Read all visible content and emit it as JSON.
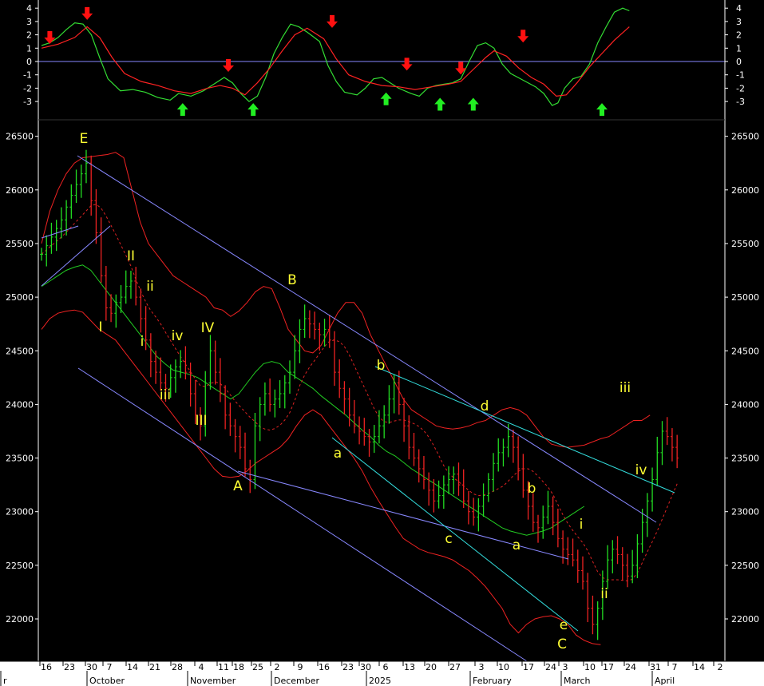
{
  "chart_data": [
    {
      "type": "line",
      "panel": "oscillator",
      "ylim": [
        -4,
        4
      ],
      "y_ticks": [
        4,
        3,
        2,
        1,
        0,
        -1,
        -2,
        -3
      ],
      "zero_line": true,
      "series": [
        {
          "color": "#33dd33",
          "points": [
            [
              0,
              1.2
            ],
            [
              10,
              1.4
            ],
            [
              20,
              1.8
            ],
            [
              30,
              2.4
            ],
            [
              40,
              2.9
            ],
            [
              50,
              2.8
            ],
            [
              60,
              2.0
            ],
            [
              70,
              0.3
            ],
            [
              80,
              -1.3
            ],
            [
              95,
              -2.2
            ],
            [
              110,
              -2.1
            ],
            [
              125,
              -2.3
            ],
            [
              140,
              -2.7
            ],
            [
              155,
              -2.9
            ],
            [
              165,
              -2.4
            ],
            [
              180,
              -2.6
            ],
            [
              195,
              -2.2
            ],
            [
              210,
              -1.6
            ],
            [
              220,
              -1.2
            ],
            [
              230,
              -1.6
            ],
            [
              240,
              -2.4
            ],
            [
              250,
              -3.0
            ],
            [
              260,
              -2.6
            ],
            [
              270,
              -1.2
            ],
            [
              280,
              0.6
            ],
            [
              290,
              1.8
            ],
            [
              300,
              2.8
            ],
            [
              310,
              2.6
            ],
            [
              320,
              2.2
            ],
            [
              335,
              1.5
            ],
            [
              345,
              -0.3
            ],
            [
              355,
              -1.5
            ],
            [
              365,
              -2.3
            ],
            [
              380,
              -2.5
            ],
            [
              390,
              -2.0
            ],
            [
              400,
              -1.3
            ],
            [
              410,
              -1.2
            ],
            [
              420,
              -1.6
            ],
            [
              430,
              -2.0
            ],
            [
              445,
              -2.4
            ],
            [
              455,
              -2.6
            ],
            [
              465,
              -2.0
            ],
            [
              475,
              -1.8
            ],
            [
              485,
              -1.7
            ],
            [
              495,
              -1.6
            ],
            [
              505,
              -1.3
            ],
            [
              515,
              0.0
            ],
            [
              525,
              1.2
            ],
            [
              535,
              1.4
            ],
            [
              545,
              1.0
            ],
            [
              555,
              -0.2
            ],
            [
              565,
              -0.9
            ],
            [
              580,
              -1.4
            ],
            [
              595,
              -1.9
            ],
            [
              605,
              -2.4
            ],
            [
              615,
              -3.3
            ],
            [
              622,
              -3.1
            ],
            [
              630,
              -2.0
            ],
            [
              640,
              -1.3
            ],
            [
              650,
              -1.1
            ],
            [
              660,
              -0.2
            ],
            [
              670,
              1.4
            ],
            [
              680,
              2.6
            ],
            [
              690,
              3.7
            ],
            [
              700,
              4.0
            ],
            [
              708,
              3.8
            ]
          ]
        },
        {
          "color": "#ff2222",
          "points": [
            [
              0,
              1.0
            ],
            [
              20,
              1.3
            ],
            [
              40,
              1.8
            ],
            [
              55,
              2.6
            ],
            [
              70,
              1.8
            ],
            [
              85,
              0.3
            ],
            [
              100,
              -0.9
            ],
            [
              120,
              -1.5
            ],
            [
              140,
              -1.8
            ],
            [
              160,
              -2.2
            ],
            [
              180,
              -2.4
            ],
            [
              200,
              -2.0
            ],
            [
              215,
              -1.8
            ],
            [
              230,
              -2.0
            ],
            [
              245,
              -2.5
            ],
            [
              260,
              -1.6
            ],
            [
              275,
              -0.5
            ],
            [
              290,
              0.8
            ],
            [
              305,
              2.0
            ],
            [
              320,
              2.5
            ],
            [
              340,
              1.7
            ],
            [
              355,
              0.2
            ],
            [
              370,
              -1.0
            ],
            [
              390,
              -1.5
            ],
            [
              410,
              -1.8
            ],
            [
              430,
              -1.9
            ],
            [
              450,
              -2.1
            ],
            [
              470,
              -1.9
            ],
            [
              490,
              -1.7
            ],
            [
              505,
              -1.5
            ],
            [
              520,
              -0.6
            ],
            [
              535,
              0.3
            ],
            [
              545,
              0.8
            ],
            [
              560,
              0.4
            ],
            [
              575,
              -0.5
            ],
            [
              590,
              -1.2
            ],
            [
              605,
              -1.7
            ],
            [
              620,
              -2.6
            ],
            [
              632,
              -2.5
            ],
            [
              645,
              -1.6
            ],
            [
              660,
              -0.4
            ],
            [
              675,
              0.6
            ],
            [
              690,
              1.6
            ],
            [
              708,
              2.6
            ]
          ]
        }
      ],
      "signals": {
        "sell": [
          [
            10,
            1.8
          ],
          [
            55,
            3.6
          ],
          [
            225,
            -0.3
          ],
          [
            350,
            3.0
          ],
          [
            440,
            -0.2
          ],
          [
            505,
            -0.5
          ],
          [
            580,
            1.9
          ]
        ],
        "buy": [
          [
            170,
            -3.6
          ],
          [
            255,
            -3.6
          ],
          [
            415,
            -2.8
          ],
          [
            480,
            -3.2
          ],
          [
            520,
            -3.2
          ],
          [
            675,
            -3.6
          ]
        ]
      }
    },
    {
      "type": "bar",
      "panel": "price",
      "ylim": [
        21500,
        26700
      ],
      "y_ticks": [
        26500,
        26000,
        25500,
        25000,
        24500,
        24000,
        23500,
        23000,
        22500,
        22000
      ],
      "x_ticks": [
        "16",
        "23",
        "30",
        "7",
        "14",
        "21",
        "28",
        "4",
        "11",
        "18",
        "25",
        "2",
        "9",
        "16",
        "23",
        "30",
        "6",
        "13",
        "20",
        "27",
        "3",
        "10",
        "17",
        "24",
        "3",
        "10",
        "17",
        "24",
        "31",
        "7",
        "14",
        "2"
      ],
      "months": [
        "r",
        "October",
        "November",
        "December",
        "2025",
        "February",
        "March",
        "April"
      ],
      "close_series": [
        25400,
        25480,
        25560,
        25640,
        25720,
        25840,
        25950,
        26050,
        26150,
        26250,
        25900,
        25600,
        25200,
        24900,
        24850,
        24950,
        25000,
        25100,
        25150,
        25000,
        24800,
        24600,
        24400,
        24300,
        24200,
        24150,
        24250,
        24350,
        24400,
        24300,
        24100,
        23900,
        23800,
        24200,
        24500,
        24300,
        24100,
        23900,
        23800,
        23700,
        23600,
        23400,
        23300,
        23800,
        24000,
        24100,
        24000,
        24050,
        24100,
        24200,
        24300,
        24500,
        24700,
        24800,
        24750,
        24700,
        24650,
        24700,
        24600,
        24300,
        24150,
        24050,
        23900,
        23800,
        23750,
        23700,
        23650,
        23700,
        23800,
        23900,
        24050,
        24200,
        24000,
        23800,
        23600,
        23500,
        23400,
        23300,
        23200,
        23100,
        23150,
        23250,
        23300,
        23350,
        23250,
        23100,
        23000,
        22950,
        23050,
        23150,
        23300,
        23450,
        23550,
        23600,
        23700,
        23600,
        23400,
        23200,
        23050,
        22900,
        22850,
        22950,
        23050,
        22900,
        22750,
        22650,
        22600,
        22550,
        22450,
        22350,
        22100,
        21950,
        22100,
        22350,
        22550,
        22650,
        22600,
        22500,
        22400,
        22500,
        22700,
        22900,
        23100,
        23300,
        23550,
        23750,
        23700,
        23600,
        23500
      ],
      "bollinger": {
        "upper": [
          25500,
          25800,
          26000,
          26150,
          26250,
          26300,
          26310,
          26320,
          26330,
          26350,
          26300,
          26000,
          25700,
          25500,
          25400,
          25300,
          25200,
          25150,
          25100,
          25050,
          25000,
          24900,
          24880,
          24820,
          24870,
          24950,
          25050,
          25100,
          25080,
          24900,
          24700,
          24600,
          24500,
          24480,
          24550,
          24700,
          24850,
          24950,
          24950,
          24850,
          24650,
          24500,
          24350,
          24200,
          24050,
          23950,
          23900,
          23850,
          23800,
          23780,
          23770,
          23780,
          23800,
          23830,
          23850,
          23900,
          23950,
          23970,
          23950,
          23900,
          23800,
          23700,
          23630,
          23610,
          23600,
          23610,
          23620,
          23650,
          23680,
          23700,
          23750,
          23800,
          23850,
          23850,
          23900
        ],
        "middle": [
          25100,
          25150,
          25200,
          25250,
          25280,
          25300,
          25250,
          25150,
          25050,
          24950,
          24850,
          24750,
          24650,
          24550,
          24450,
          24380,
          24320,
          24300,
          24280,
          24250,
          24200,
          24150,
          24100,
          24050,
          24100,
          24200,
          24300,
          24380,
          24400,
          24380,
          24300,
          24250,
          24200,
          24150,
          24080,
          24020,
          23960,
          23900,
          23830,
          23760,
          23700,
          23620,
          23560,
          23520,
          23460,
          23400,
          23350,
          23300,
          23250,
          23200,
          23150,
          23100,
          23050,
          23000,
          22950,
          22900,
          22850,
          22820,
          22800,
          22780,
          22800,
          22820,
          22850,
          22900,
          22950,
          23000,
          23050
        ],
        "lower": [
          24700,
          24800,
          24850,
          24870,
          24880,
          24860,
          24780,
          24700,
          24650,
          24600,
          24500,
          24400,
          24300,
          24200,
          24100,
          24000,
          23900,
          23800,
          23700,
          23600,
          23500,
          23400,
          23330,
          23320,
          23330,
          23380,
          23450,
          23500,
          23550,
          23600,
          23680,
          23800,
          23900,
          23950,
          23900,
          23800,
          23700,
          23600,
          23500,
          23380,
          23230,
          23100,
          22980,
          22860,
          22750,
          22700,
          22650,
          22620,
          22600,
          22580,
          22550,
          22500,
          22450,
          22380,
          22300,
          22200,
          22100,
          21950,
          21870,
          21950,
          22000,
          22020,
          22030,
          22000,
          21950,
          21850,
          21800,
          21770,
          21760
        ]
      },
      "trendlines": [
        {
          "color": "#8888ff",
          "from": [
            "E",
            26250
          ],
          "to": [
            "mar-end",
            22830
          ]
        },
        {
          "color": "#8888ff",
          "from": [
            "sep-16",
            24200
          ],
          "to": [
            "feb-24",
            21600
          ]
        },
        {
          "color": "#8888ff",
          "from": [
            "A",
            23300
          ],
          "to": [
            "mar-3",
            22500
          ]
        },
        {
          "color": "#8888ff",
          "from": [
            "sep-16",
            25400
          ],
          "to": [
            "sep-30",
            25570
          ]
        },
        {
          "color": "#8888ff",
          "from": [
            "sep-16",
            25000
          ],
          "to": [
            "oct-7",
            25600
          ]
        },
        {
          "color": "#33dddd",
          "from": [
            "b",
            24230
          ],
          "to": [
            "apr-7",
            23100
          ]
        },
        {
          "color": "#33dddd",
          "from": [
            "a",
            23620
          ],
          "to": [
            "C",
            21880
          ]
        }
      ],
      "labels": [
        {
          "text": "E",
          "x": "oct-1",
          "y": 26350
        },
        {
          "text": "I",
          "x": "oct-8",
          "y": 24550
        },
        {
          "text": "II",
          "x": "oct-16",
          "y": 25200
        },
        {
          "text": "ii",
          "x": "oct-21",
          "y": 24950
        },
        {
          "text": "i",
          "x": "oct-18",
          "y": 24400
        },
        {
          "text": "iv",
          "x": "oct-29",
          "y": 24450
        },
        {
          "text": "iii",
          "x": "oct-25",
          "y": 23900
        },
        {
          "text": "IV",
          "x": "nov-7",
          "y": 24500
        },
        {
          "text": "III",
          "x": "nov-4",
          "y": 23700
        },
        {
          "text": "A",
          "x": "nov-15",
          "y": 23100
        },
        {
          "text": "B",
          "x": "dec-13",
          "y": 25100
        },
        {
          "text": "a",
          "x": "dec-22",
          "y": 23400
        },
        {
          "text": "b",
          "x": "jan-7",
          "y": 24200
        },
        {
          "text": "c",
          "x": "jan-22",
          "y": 22650
        },
        {
          "text": "d",
          "x": "feb-3",
          "y": 23800
        },
        {
          "text": "b",
          "x": "feb-17",
          "y": 23100
        },
        {
          "text": "a",
          "x": "feb-13",
          "y": 22550
        },
        {
          "text": "i",
          "x": "mar-8",
          "y": 22700
        },
        {
          "text": "ii",
          "x": "mar-13",
          "y": 22200
        },
        {
          "text": "e",
          "x": "mar-2",
          "y": 21900
        },
        {
          "text": "C",
          "x": "mar-2",
          "y": 21700
        },
        {
          "text": "iii",
          "x": "mar-20",
          "y": 24000
        },
        {
          "text": "iv",
          "x": "mar-27",
          "y": 23350
        }
      ]
    }
  ]
}
